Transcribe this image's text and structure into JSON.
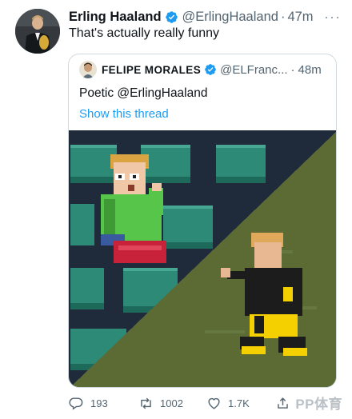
{
  "tweet": {
    "author_name": "Erling Haaland",
    "author_handle": "@ErlingHaaland",
    "separator": "·",
    "time": "47m",
    "more_glyph": "···",
    "text": "That's actually really funny"
  },
  "quoted_tweet": {
    "author_name": "FELIPE MORALES",
    "author_handle": "@ELFranc...",
    "separator": "·",
    "time": "48m",
    "text": "Poetic @ErlingHaaland",
    "show_thread_label": "Show this thread"
  },
  "actions": {
    "reply_count": "193",
    "retweet_count": "1002",
    "like_count": "1.7K"
  },
  "watermark": "PP体育",
  "colors": {
    "verified_blue": "#1d9bf0",
    "link_blue": "#1d9bf0",
    "secondary_text": "#536471",
    "pixel_art_stadium_bg": "#1f2a3a",
    "pixel_art_seat_teal": "#2c8a77",
    "pixel_art_grass": "#5c6b34"
  },
  "icons": {
    "verified": "verified-badge-icon",
    "reply": "reply-icon",
    "retweet": "retweet-icon",
    "like": "heart-icon",
    "share": "share-icon",
    "more": "more-icon"
  }
}
